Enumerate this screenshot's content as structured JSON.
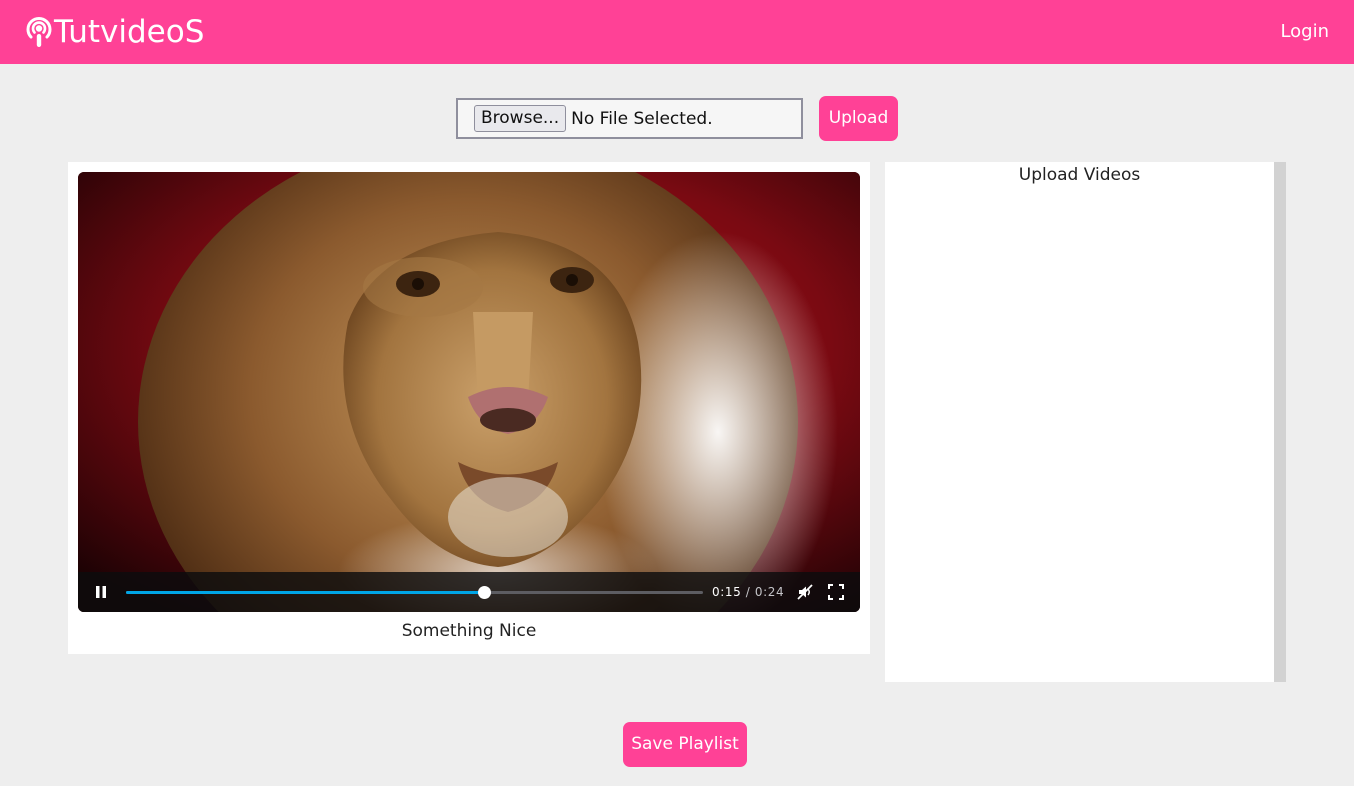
{
  "brand": {
    "name": "TutvideoS",
    "icon": "podcast-icon"
  },
  "nav": {
    "login_label": "Login"
  },
  "upload": {
    "browse_label": "Browse...",
    "file_status": "No File Selected.",
    "upload_label": "Upload"
  },
  "player": {
    "video_title": "Something Nice",
    "current_time": "0:15",
    "separator": "/",
    "duration": "0:24",
    "progress_fraction": 0.62,
    "muted": true,
    "playing": true,
    "icons": [
      "pause-icon",
      "mute-icon",
      "fullscreen-icon"
    ]
  },
  "playlist": {
    "title": "Upload Videos",
    "items": []
  },
  "actions": {
    "save_label": "Save Playlist"
  },
  "colors": {
    "accent": "#ff4196",
    "progress": "#00a5e6",
    "page_bg": "#eeeeee"
  }
}
